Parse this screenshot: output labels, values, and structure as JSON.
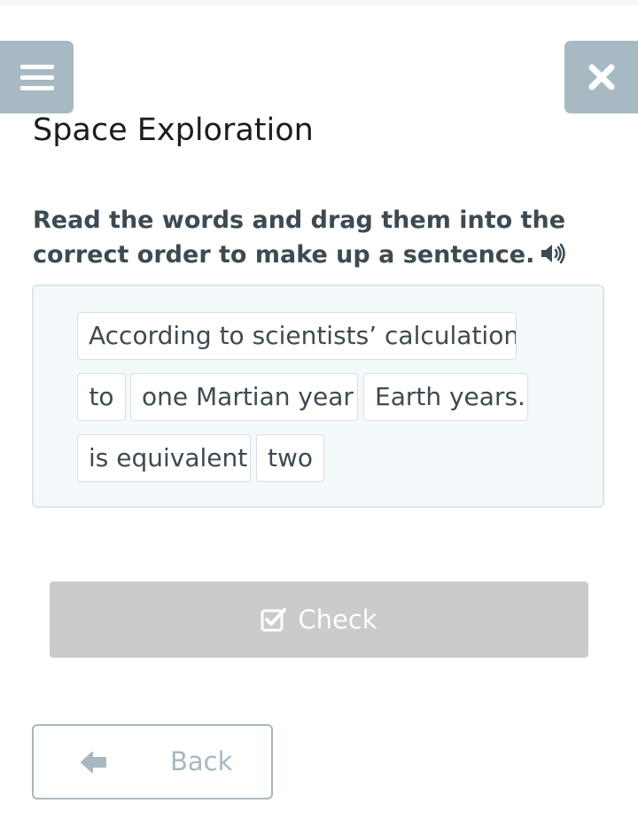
{
  "header": {
    "menu_icon": "hamburger-menu-icon",
    "close_icon": "close-x-icon",
    "title": "Space Exploration"
  },
  "task": {
    "instruction": "Read the words and drag them into the correct order to make up a sentence.",
    "audio_icon": "speaker-icon"
  },
  "words": [
    "According to scientists’ calculations",
    "to",
    "one Martian year",
    "Earth years.",
    "is equivalent",
    "two"
  ],
  "actions": {
    "check_label": "Check",
    "check_icon": "checkbox-check-icon",
    "back_label": "Back",
    "back_icon": "arrow-left-icon"
  },
  "colors": {
    "header_buttons": "#a7bac4",
    "drop_area_bg": "#f4fafb",
    "check_button_disabled": "#cbcbcb",
    "back_border": "#a6b8c0"
  }
}
